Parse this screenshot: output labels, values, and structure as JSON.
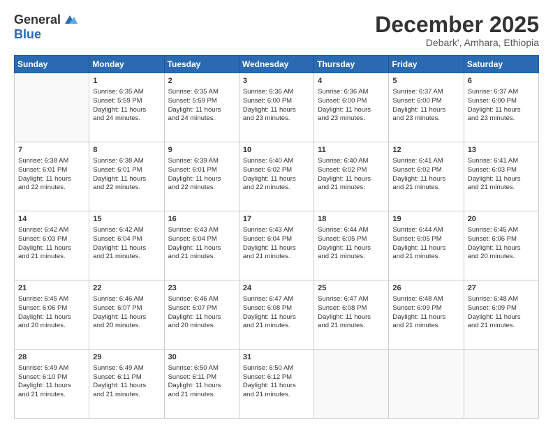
{
  "header": {
    "logo_general": "General",
    "logo_blue": "Blue",
    "month_title": "December 2025",
    "location": "Debark', Amhara, Ethiopia"
  },
  "days_of_week": [
    "Sunday",
    "Monday",
    "Tuesday",
    "Wednesday",
    "Thursday",
    "Friday",
    "Saturday"
  ],
  "weeks": [
    [
      {
        "day": "",
        "info": ""
      },
      {
        "day": "1",
        "info": "Sunrise: 6:35 AM\nSunset: 5:59 PM\nDaylight: 11 hours\nand 24 minutes."
      },
      {
        "day": "2",
        "info": "Sunrise: 6:35 AM\nSunset: 5:59 PM\nDaylight: 11 hours\nand 24 minutes."
      },
      {
        "day": "3",
        "info": "Sunrise: 6:36 AM\nSunset: 6:00 PM\nDaylight: 11 hours\nand 23 minutes."
      },
      {
        "day": "4",
        "info": "Sunrise: 6:36 AM\nSunset: 6:00 PM\nDaylight: 11 hours\nand 23 minutes."
      },
      {
        "day": "5",
        "info": "Sunrise: 6:37 AM\nSunset: 6:00 PM\nDaylight: 11 hours\nand 23 minutes."
      },
      {
        "day": "6",
        "info": "Sunrise: 6:37 AM\nSunset: 6:00 PM\nDaylight: 11 hours\nand 23 minutes."
      }
    ],
    [
      {
        "day": "7",
        "info": "Sunrise: 6:38 AM\nSunset: 6:01 PM\nDaylight: 11 hours\nand 22 minutes."
      },
      {
        "day": "8",
        "info": "Sunrise: 6:38 AM\nSunset: 6:01 PM\nDaylight: 11 hours\nand 22 minutes."
      },
      {
        "day": "9",
        "info": "Sunrise: 6:39 AM\nSunset: 6:01 PM\nDaylight: 11 hours\nand 22 minutes."
      },
      {
        "day": "10",
        "info": "Sunrise: 6:40 AM\nSunset: 6:02 PM\nDaylight: 11 hours\nand 22 minutes."
      },
      {
        "day": "11",
        "info": "Sunrise: 6:40 AM\nSunset: 6:02 PM\nDaylight: 11 hours\nand 21 minutes."
      },
      {
        "day": "12",
        "info": "Sunrise: 6:41 AM\nSunset: 6:02 PM\nDaylight: 11 hours\nand 21 minutes."
      },
      {
        "day": "13",
        "info": "Sunrise: 6:41 AM\nSunset: 6:03 PM\nDaylight: 11 hours\nand 21 minutes."
      }
    ],
    [
      {
        "day": "14",
        "info": "Sunrise: 6:42 AM\nSunset: 6:03 PM\nDaylight: 11 hours\nand 21 minutes."
      },
      {
        "day": "15",
        "info": "Sunrise: 6:42 AM\nSunset: 6:04 PM\nDaylight: 11 hours\nand 21 minutes."
      },
      {
        "day": "16",
        "info": "Sunrise: 6:43 AM\nSunset: 6:04 PM\nDaylight: 11 hours\nand 21 minutes."
      },
      {
        "day": "17",
        "info": "Sunrise: 6:43 AM\nSunset: 6:04 PM\nDaylight: 11 hours\nand 21 minutes."
      },
      {
        "day": "18",
        "info": "Sunrise: 6:44 AM\nSunset: 6:05 PM\nDaylight: 11 hours\nand 21 minutes."
      },
      {
        "day": "19",
        "info": "Sunrise: 6:44 AM\nSunset: 6:05 PM\nDaylight: 11 hours\nand 21 minutes."
      },
      {
        "day": "20",
        "info": "Sunrise: 6:45 AM\nSunset: 6:06 PM\nDaylight: 11 hours\nand 20 minutes."
      }
    ],
    [
      {
        "day": "21",
        "info": "Sunrise: 6:45 AM\nSunset: 6:06 PM\nDaylight: 11 hours\nand 20 minutes."
      },
      {
        "day": "22",
        "info": "Sunrise: 6:46 AM\nSunset: 6:07 PM\nDaylight: 11 hours\nand 20 minutes."
      },
      {
        "day": "23",
        "info": "Sunrise: 6:46 AM\nSunset: 6:07 PM\nDaylight: 11 hours\nand 20 minutes."
      },
      {
        "day": "24",
        "info": "Sunrise: 6:47 AM\nSunset: 6:08 PM\nDaylight: 11 hours\nand 21 minutes."
      },
      {
        "day": "25",
        "info": "Sunrise: 6:47 AM\nSunset: 6:08 PM\nDaylight: 11 hours\nand 21 minutes."
      },
      {
        "day": "26",
        "info": "Sunrise: 6:48 AM\nSunset: 6:09 PM\nDaylight: 11 hours\nand 21 minutes."
      },
      {
        "day": "27",
        "info": "Sunrise: 6:48 AM\nSunset: 6:09 PM\nDaylight: 11 hours\nand 21 minutes."
      }
    ],
    [
      {
        "day": "28",
        "info": "Sunrise: 6:49 AM\nSunset: 6:10 PM\nDaylight: 11 hours\nand 21 minutes."
      },
      {
        "day": "29",
        "info": "Sunrise: 6:49 AM\nSunset: 6:11 PM\nDaylight: 11 hours\nand 21 minutes."
      },
      {
        "day": "30",
        "info": "Sunrise: 6:50 AM\nSunset: 6:11 PM\nDaylight: 11 hours\nand 21 minutes."
      },
      {
        "day": "31",
        "info": "Sunrise: 6:50 AM\nSunset: 6:12 PM\nDaylight: 11 hours\nand 21 minutes."
      },
      {
        "day": "",
        "info": ""
      },
      {
        "day": "",
        "info": ""
      },
      {
        "day": "",
        "info": ""
      }
    ]
  ]
}
